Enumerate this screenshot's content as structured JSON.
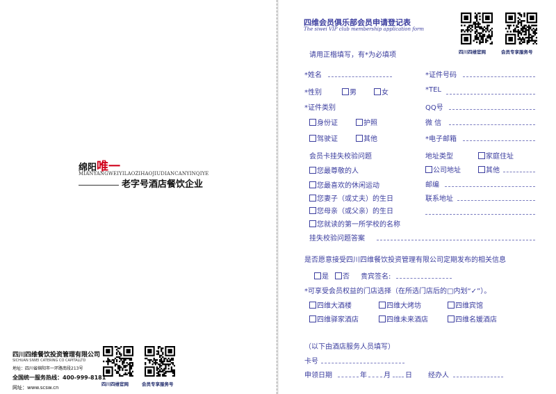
{
  "left": {
    "brand_prefix": "绵阳",
    "brand_highlight": "唯一",
    "brand_pinyin": "MIANYANGWEIYILAOZIHAOJIUDIANCANYINQIYE",
    "brand_tagline": "老字号酒店餐饮企业",
    "company_name": "四川四维餐饮投资管理有限公司",
    "company_en": "SICHUAN SIWEI CATERING CO CAPITALLTD",
    "address": "地址：四川省绵阳市一环路南段213号",
    "hotline": "全国统一服务热线：400-999-8181",
    "website": "网址：www.scsw.cn",
    "qr1_caption": "四川四维官网",
    "qr2_caption": "会员专享服务号"
  },
  "form": {
    "title": "四维会员俱乐部会员申请登记表",
    "subtitle": "The siwei VIP club membership application form",
    "qr1_caption": "四川四维官网",
    "qr2_caption": "会员专享服务号",
    "instruction": "请用正楷填写，有*为必填项",
    "name": "*姓名",
    "id_number": "*证件号码",
    "gender": "*性别",
    "male": "男",
    "female": "女",
    "tel": "*TEL",
    "id_type": "*证件类别",
    "qq": "QQ号",
    "id_card": "身份证",
    "passport": "护照",
    "wechat": "微  信",
    "driver_license": "驾驶证",
    "other": "其他",
    "email": "*电子邮箱",
    "security_question": "会员卡挂失校验问题",
    "address_type": "地址类型",
    "home_address": "家庭住址",
    "q1": "您最尊敬的人",
    "company_address": "公司地址",
    "addr_other": "其他",
    "q2": "您最喜欢的休闲运动",
    "postcode": "邮编",
    "q3": "您妻子（或丈夫）的生日",
    "contact_address": "联系地址",
    "q4": "您母亲（或父亲）的生日",
    "q5": "您就读的第一所学校的名称",
    "answer": "挂失校验问题答案",
    "consent": "是否愿意接受四川四维餐饮投资管理有限公司定期发布的相关信息",
    "yes": "是",
    "no": "否",
    "signature": "贵宾签名:",
    "store_select": "*可享受会员权益的门店选择（在所选门店后的□内划“✓”）。",
    "stores": [
      "四维大酒楼",
      "四维大烤坊",
      "四维宾馆",
      "四维驿家酒店",
      "四维未来酒店",
      "四维名媛酒店"
    ],
    "staff_note": "（以下由酒店服务人员填写）",
    "card_no": "卡号",
    "issue_date": "申领日期",
    "year": "年",
    "month": "月",
    "day": "日",
    "handler": "经办人"
  }
}
